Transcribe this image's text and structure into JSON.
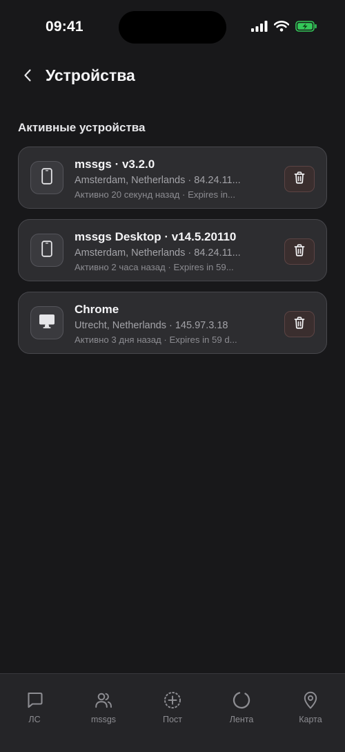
{
  "status_bar": {
    "time": "09:41"
  },
  "header": {
    "title": "Устройства"
  },
  "section": {
    "label": "Активные устройства"
  },
  "devices": [
    {
      "name": "mssgs · v3.2.0",
      "location": "Amsterdam, Netherlands · 84.24.11...",
      "activity": "Активно 20 секунд назад · Expires in...",
      "icon": "phone-icon"
    },
    {
      "name": "mssgs Desktop · v14.5.20110",
      "location": "Amsterdam, Netherlands · 84.24.11...",
      "activity": "Активно 2 часа назад · Expires in 59...",
      "icon": "phone-icon"
    },
    {
      "name": "Chrome",
      "location": "Utrecht, Netherlands · 145.97.3.18",
      "activity": "Активно 3 дня назад · Expires in 59 d...",
      "icon": "monitor-icon"
    }
  ],
  "tabbar": {
    "items": [
      {
        "label": "ЛС",
        "icon": "chat-bubble-icon"
      },
      {
        "label": "mssgs",
        "icon": "users-icon"
      },
      {
        "label": "Пост",
        "icon": "plus-circle-icon"
      },
      {
        "label": "Лента",
        "icon": "loading-circle-icon"
      },
      {
        "label": "Карта",
        "icon": "map-pin-icon"
      }
    ]
  },
  "colors": {
    "background": "#18181a",
    "card": "#2d2d30",
    "battery": "#34c759",
    "delete_button": "#3a2e2e"
  }
}
